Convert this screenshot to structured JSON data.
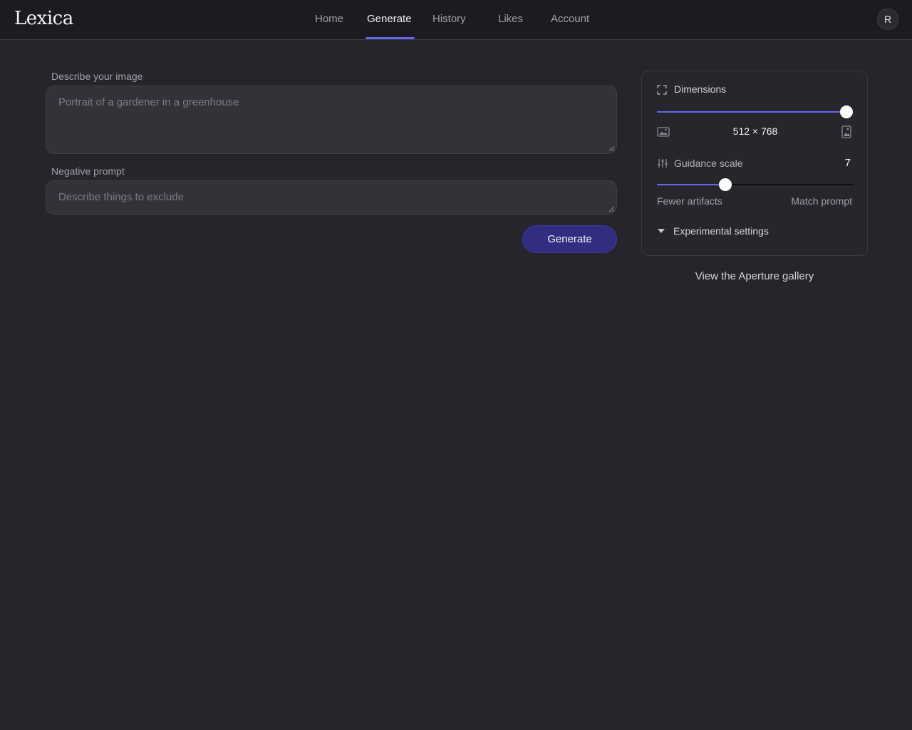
{
  "header": {
    "logo": "Lexica",
    "nav": [
      {
        "label": "Home",
        "active": false
      },
      {
        "label": "Generate",
        "active": true
      },
      {
        "label": "History",
        "active": false
      },
      {
        "label": "Likes",
        "active": false
      },
      {
        "label": "Account",
        "active": false
      }
    ],
    "avatar_initial": "R"
  },
  "form": {
    "prompt_label": "Describe your image",
    "prompt_placeholder": "Portrait of a gardener in a greenhouse",
    "prompt_value": "",
    "negative_label": "Negative prompt",
    "negative_placeholder": "Describe things to exclude",
    "negative_value": "",
    "generate_label": "Generate"
  },
  "settings": {
    "dimensions_label": "Dimensions",
    "dimensions_value": "512 × 768",
    "dimensions_slider_fraction": 1.0,
    "guidance_label": "Guidance scale",
    "guidance_value": "7",
    "guidance_slider_fraction": 0.34,
    "guidance_min_label": "Fewer artifacts",
    "guidance_max_label": "Match prompt",
    "experimental_label": "Experimental settings"
  },
  "gallery_link": "View the Aperture gallery",
  "colors": {
    "accent": "#6366f1",
    "button_bg": "#312e81",
    "background": "#25252b",
    "header_bg": "#1c1c20"
  },
  "icons": {
    "dimensions": "expand-corners-icon",
    "landscape": "landscape-image-icon",
    "portrait": "portrait-image-icon",
    "guidance": "sliders-icon",
    "experimental": "caret-down-icon"
  }
}
